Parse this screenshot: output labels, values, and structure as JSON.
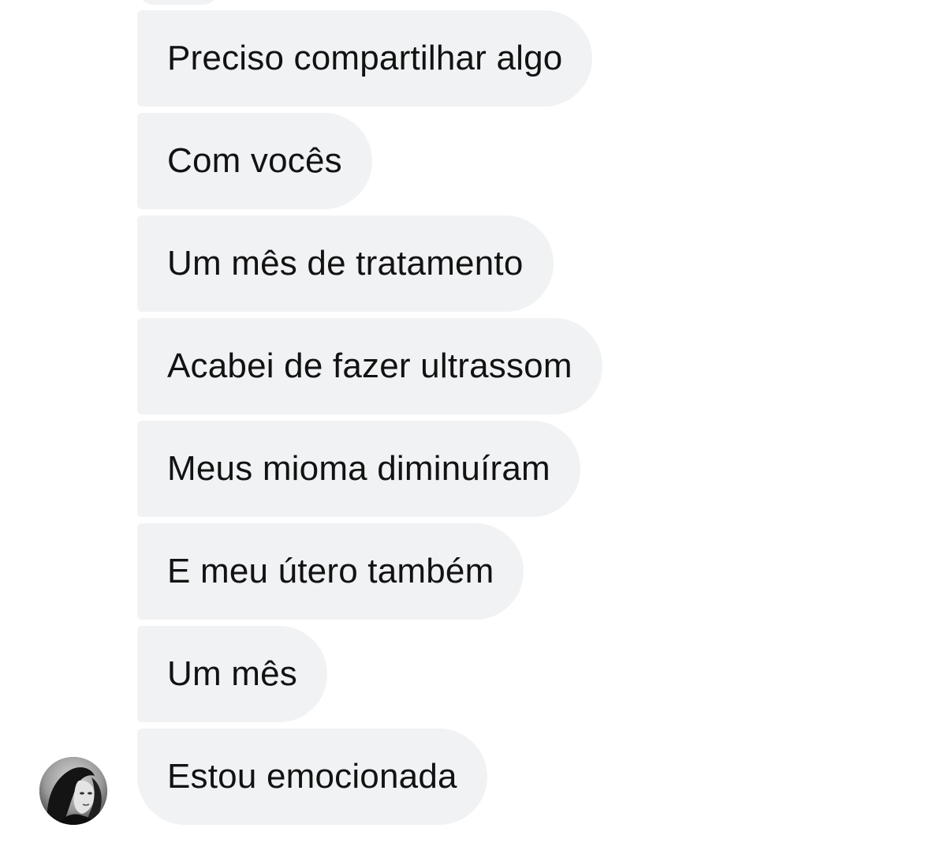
{
  "conversation": {
    "messages": [
      {
        "text": "Preciso compartilhar algo"
      },
      {
        "text": "Com vocês"
      },
      {
        "text": "Um mês de tratamento"
      },
      {
        "text": "Acabei de fazer ultrassom"
      },
      {
        "text": "Meus mioma diminuíram"
      },
      {
        "text": "E meu útero também"
      },
      {
        "text": "Um mês"
      },
      {
        "text": "Estou emocionada"
      }
    ]
  },
  "colors": {
    "bubble_background": "#f1f2f4",
    "text": "#121212",
    "background": "#ffffff"
  },
  "icons": {
    "sender_avatar": "profile-photo"
  }
}
